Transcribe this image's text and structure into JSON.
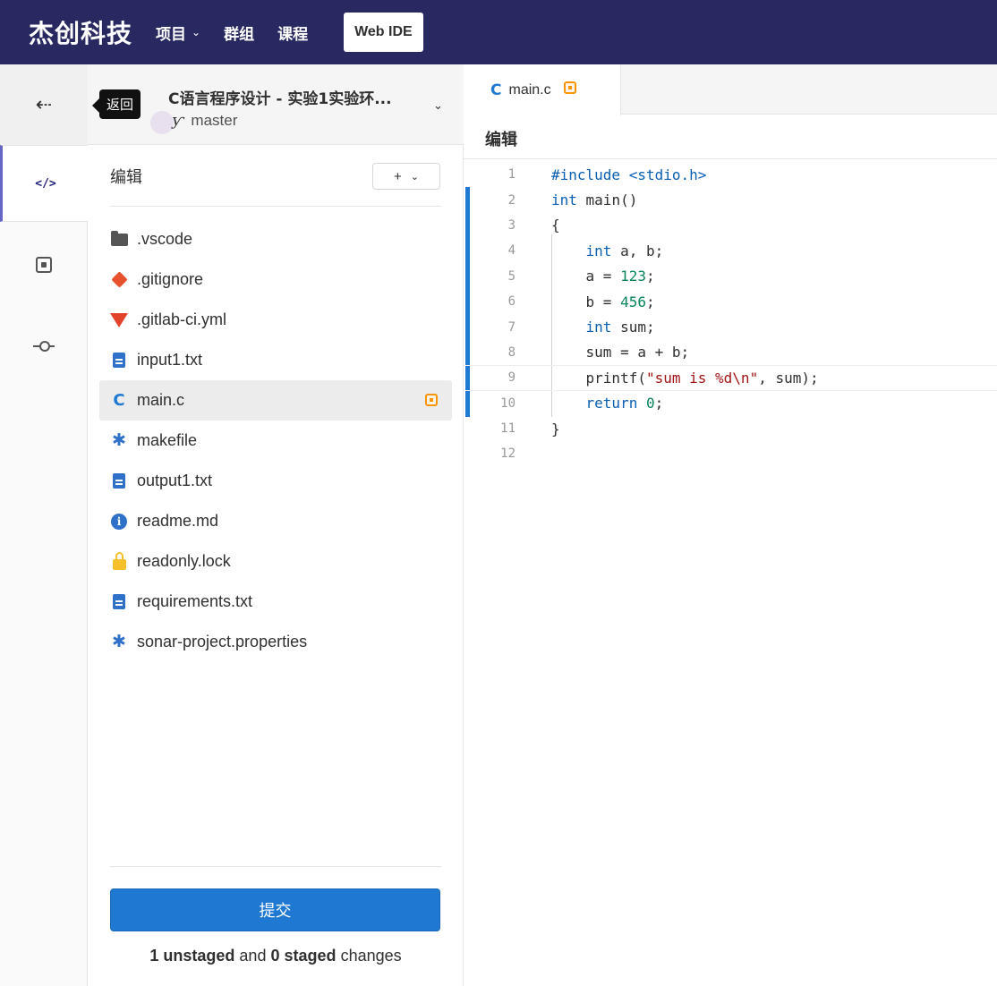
{
  "nav": {
    "brand": "杰创科技",
    "items": [
      {
        "label": "项目",
        "has_dropdown": true
      },
      {
        "label": "群组",
        "has_dropdown": false
      },
      {
        "label": "课程",
        "has_dropdown": false
      }
    ],
    "web_ide": "Web IDE"
  },
  "activity": {
    "back_tooltip": "返回",
    "items": [
      {
        "name": "edit",
        "icon": "code-icon",
        "glyph": "</>",
        "active": true
      },
      {
        "name": "review",
        "icon": "review-icon",
        "active": false
      },
      {
        "name": "commit",
        "icon": "commit-icon",
        "active": false
      }
    ]
  },
  "project": {
    "title": "C语言程序设计 - 实验1实验环...",
    "branch_icon": "ƴ",
    "branch": "master"
  },
  "file_panel": {
    "heading": "编辑",
    "add_button": "+",
    "files": [
      {
        "name": ".vscode",
        "icon": "folder-icon",
        "selected": false,
        "modified": false
      },
      {
        "name": ".gitignore",
        "icon": "git-icon",
        "selected": false,
        "modified": false
      },
      {
        "name": ".gitlab-ci.yml",
        "icon": "gitlab-icon",
        "selected": false,
        "modified": false
      },
      {
        "name": "input1.txt",
        "icon": "document-icon",
        "selected": false,
        "modified": false
      },
      {
        "name": "main.c",
        "icon": "c-file-icon",
        "selected": true,
        "modified": true
      },
      {
        "name": "makefile",
        "icon": "gear-icon",
        "selected": false,
        "modified": false
      },
      {
        "name": "output1.txt",
        "icon": "document-icon",
        "selected": false,
        "modified": false
      },
      {
        "name": "readme.md",
        "icon": "info-icon",
        "selected": false,
        "modified": false
      },
      {
        "name": "readonly.lock",
        "icon": "lock-icon",
        "selected": false,
        "modified": false
      },
      {
        "name": "requirements.txt",
        "icon": "document-icon",
        "selected": false,
        "modified": false
      },
      {
        "name": "sonar-project.properties",
        "icon": "gear-icon",
        "selected": false,
        "modified": false
      }
    ],
    "commit_button": "提交",
    "changes": {
      "unstaged_count": "1",
      "unstaged_word": "unstaged",
      "and": "and",
      "staged_count": "0",
      "staged_word": "staged",
      "suffix": "changes"
    }
  },
  "editor": {
    "tab": {
      "c_glyph": "C",
      "name": "main.c",
      "modified": true
    },
    "mode_label": "编辑",
    "lines": [
      {
        "n": "1",
        "code": "#include <stdio.h>"
      },
      {
        "n": "2",
        "code": "int main()"
      },
      {
        "n": "3",
        "code": "{"
      },
      {
        "n": "4",
        "code": "    int a, b;"
      },
      {
        "n": "5",
        "code": "    a = 123;"
      },
      {
        "n": "6",
        "code": "    b = 456;"
      },
      {
        "n": "7",
        "code": "    int sum;"
      },
      {
        "n": "8",
        "code": "    sum = a + b;"
      },
      {
        "n": "9",
        "code": "    printf(\"sum is %d\\n\", sum);"
      },
      {
        "n": "10",
        "code": "    return 0;"
      },
      {
        "n": "11",
        "code": "}"
      },
      {
        "n": "12",
        "code": ""
      }
    ],
    "current_line": 9
  }
}
